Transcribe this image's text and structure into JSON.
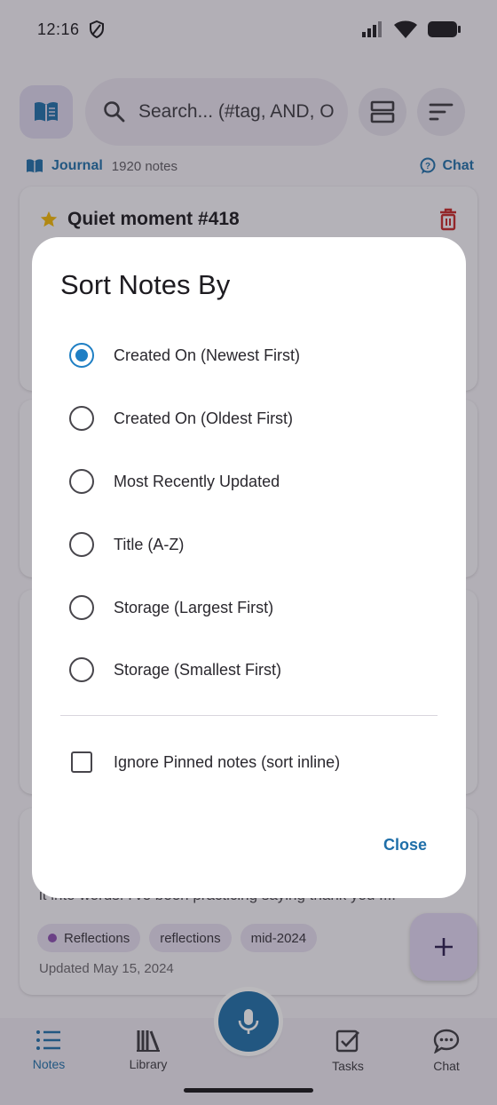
{
  "status_bar": {
    "time": "12:16"
  },
  "top_bar": {
    "search_placeholder": "Search... (#tag, AND, O"
  },
  "sub_bar": {
    "journal_label": "Journal",
    "note_count": "1920 notes",
    "chat_label": "Chat"
  },
  "cards": [
    {
      "title": "Quiet moment #418",
      "starred": true
    },
    {
      "excerpt": "it into words. I've been practicing saying thank you f...",
      "tags": [
        "Reflections",
        "reflections",
        "mid-2024"
      ],
      "updated": "Updated May 15, 2024"
    }
  ],
  "nav": {
    "items": [
      {
        "label": "Notes",
        "icon": "list-icon",
        "active": true
      },
      {
        "label": "Library",
        "icon": "library-icon",
        "active": false
      },
      {
        "label": "Tasks",
        "icon": "tasks-icon",
        "active": false
      },
      {
        "label": "Chat",
        "icon": "chat-icon",
        "active": false
      }
    ]
  },
  "dialog": {
    "title": "Sort Notes By",
    "options": [
      {
        "label": "Created On (Newest First)",
        "selected": true
      },
      {
        "label": "Created On (Oldest First)",
        "selected": false
      },
      {
        "label": "Most Recently Updated",
        "selected": false
      },
      {
        "label": "Title (A-Z)",
        "selected": false
      },
      {
        "label": "Storage (Largest First)",
        "selected": false
      },
      {
        "label": "Storage (Smallest First)",
        "selected": false
      }
    ],
    "ignore_pinned": {
      "label": "Ignore Pinned notes (sort inline)",
      "checked": false
    },
    "close_label": "Close"
  },
  "colors": {
    "accent": "#1f6fa9",
    "radio_selected": "#1f7fc4",
    "fab": "#e1d6f2",
    "tag_bg": "#e5deef",
    "trash": "#c62828",
    "star": "#f2b705"
  }
}
